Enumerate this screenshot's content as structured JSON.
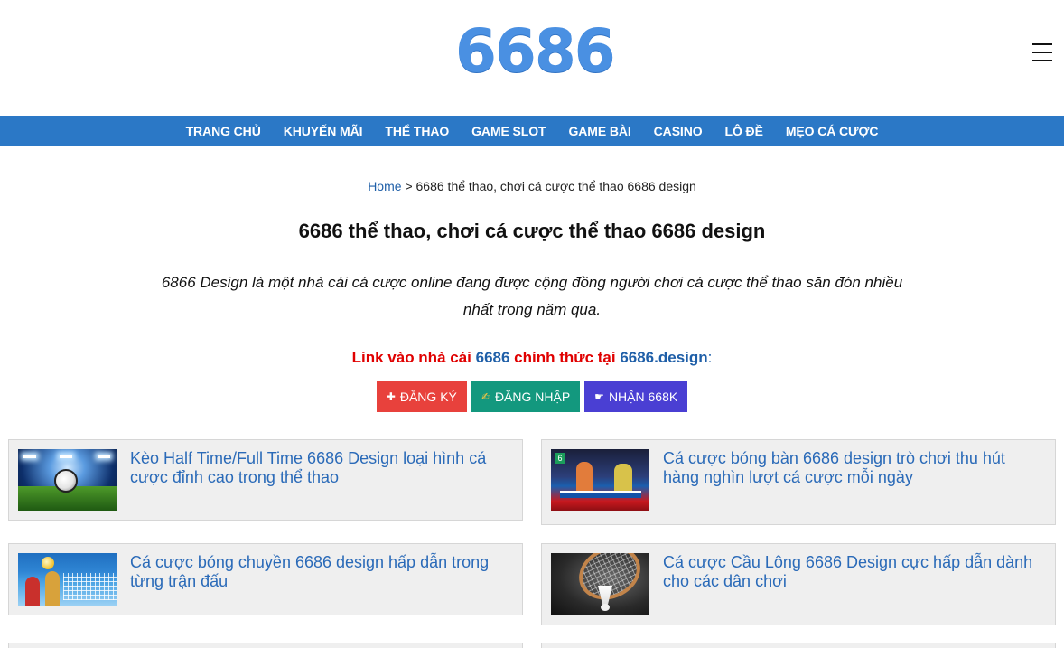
{
  "header": {
    "logo_text": "6686",
    "menu_icon": "hamburger-icon"
  },
  "nav": {
    "items": [
      {
        "label": "TRANG CHỦ"
      },
      {
        "label": "KHUYẾN MÃI"
      },
      {
        "label": "THỂ THAO"
      },
      {
        "label": "GAME SLOT"
      },
      {
        "label": "GAME BÀI"
      },
      {
        "label": "CASINO"
      },
      {
        "label": "LÔ ĐỀ"
      },
      {
        "label": "MẸO CÁ CƯỢC"
      }
    ]
  },
  "breadcrumb": {
    "home": "Home",
    "separator": ">",
    "current": "6686 thể thao, chơi cá cược thể thao 6686 design"
  },
  "page": {
    "title": "6686 thể thao, chơi cá cược thể thao 6686 design",
    "intro_line1": "6866 Design là một nhà cái cá cược online đang được cộng đồng người chơi cá cược thể thao săn đón nhiều",
    "intro_line2": "nhất trong năm qua."
  },
  "link_line": {
    "part1": "Link vào nhà cái ",
    "brand": "6686",
    "part2": " chính thức tại ",
    "domain": "6686.design",
    "colon": ":"
  },
  "buttons": {
    "register": {
      "icon": "plus-icon",
      "glyph": "✚",
      "label": "ĐĂNG KÝ",
      "color": "#e8413c"
    },
    "login": {
      "icon": "pencil-icon",
      "glyph": "✍",
      "label": "ĐĂNG NHẬP",
      "color": "#13987e"
    },
    "bonus": {
      "icon": "pointing-hand-icon",
      "glyph": "☛",
      "label": "NHẬN 668K",
      "color": "#4a3fd3"
    }
  },
  "articles": [
    {
      "title": "Kèo Half Time/Full Time 6686 Design loại hình cá cược đỉnh cao trong thể thao",
      "image": "football-stadium-image"
    },
    {
      "title": "Cá cược bóng bàn 6686 design trò chơi thu hút hàng nghìn lượt cá cược mỗi ngày",
      "image": "table-tennis-image"
    },
    {
      "title": "Cá cược bóng chuyền 6686 design hấp dẫn trong từng trận đấu",
      "image": "volleyball-image"
    },
    {
      "title": "Cá cược Cầu Lông 6686 Design cực hấp dẫn dành cho các dân chơi",
      "image": "badminton-image"
    }
  ],
  "colors": {
    "nav_bg": "#2b78c6",
    "logo": "#4a90e2",
    "link": "#2a6ab8",
    "red_text": "#e00000",
    "card_bg": "#efefef"
  }
}
